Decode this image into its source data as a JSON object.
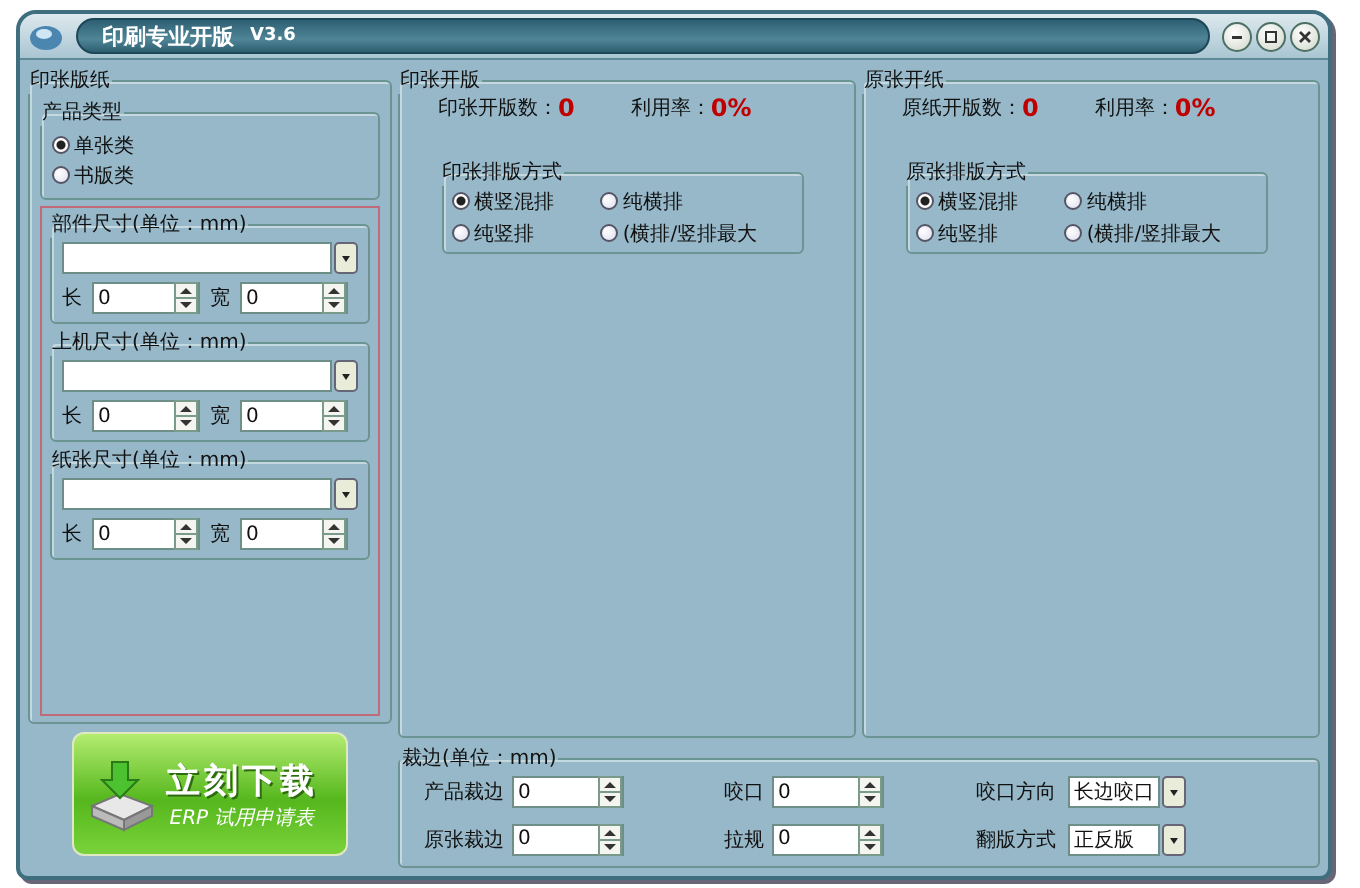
{
  "window": {
    "title": "印刷专业开版",
    "version": "V3.6"
  },
  "left_panel": {
    "title": "印张版纸",
    "product_type": {
      "title": "产品类型",
      "options": [
        {
          "label": "单张类",
          "selected": true
        },
        {
          "label": "书版类",
          "selected": false
        }
      ]
    },
    "size_groups": [
      {
        "title": "部件尺寸(单位：mm)",
        "length_label": "长",
        "length_value": "0",
        "width_label": "宽",
        "width_value": "0"
      },
      {
        "title": "上机尺寸(单位：mm)",
        "length_label": "长",
        "length_value": "0",
        "width_label": "宽",
        "width_value": "0"
      },
      {
        "title": "纸张尺寸(单位：mm)",
        "length_label": "长",
        "length_value": "0",
        "width_label": "宽",
        "width_value": "0"
      }
    ]
  },
  "download_button": {
    "title": "立刻下载",
    "subtitle": "ERP 试用申请表"
  },
  "layout_panels": [
    {
      "title": "印张开版",
      "count_label": "印张开版数：",
      "count": "0",
      "rate_label": "利用率：",
      "rate": "0%",
      "method": {
        "title": "印张排版方式",
        "options": [
          {
            "label": "横竖混排",
            "selected": true
          },
          {
            "label": "纯横排",
            "selected": false
          },
          {
            "label": "纯竖排",
            "selected": false
          },
          {
            "label": "(横排/竖排最大",
            "selected": false
          }
        ]
      }
    },
    {
      "title": "原张开纸",
      "count_label": "原纸开版数：",
      "count": "0",
      "rate_label": "利用率：",
      "rate": "0%",
      "method": {
        "title": "原张排版方式",
        "options": [
          {
            "label": "横竖混排",
            "selected": true
          },
          {
            "label": "纯横排",
            "selected": false
          },
          {
            "label": "纯竖排",
            "selected": false
          },
          {
            "label": "(横排/竖排最大",
            "selected": false
          }
        ]
      }
    }
  ],
  "trim": {
    "title": "裁边(单位：mm)",
    "fields": [
      {
        "label": "产品裁边",
        "value": "0"
      },
      {
        "label": "原张裁边",
        "value": "0"
      },
      {
        "label": "咬口",
        "value": "0"
      },
      {
        "label": "拉规",
        "value": "0"
      }
    ],
    "selects": [
      {
        "label": "咬口方向",
        "value": "长边咬口"
      },
      {
        "label": "翻版方式",
        "value": "正反版"
      }
    ]
  }
}
